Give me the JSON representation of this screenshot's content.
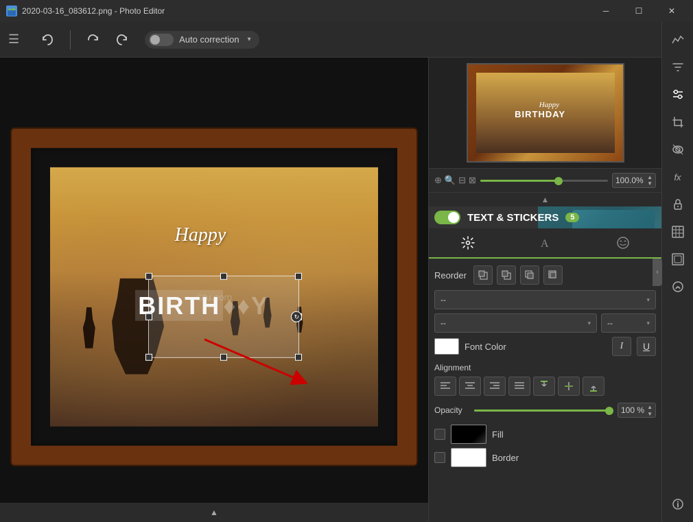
{
  "window": {
    "title": "2020-03-16_083612.png - Photo Editor",
    "icon": "photo-editor-icon"
  },
  "toolbar": {
    "hamburger_label": "☰",
    "undo_label": "↩",
    "redo_prev_label": "↩",
    "redo_label": "↪",
    "autocorrection_label": "Auto correction",
    "autocorrection_arrow": "▾"
  },
  "zoom": {
    "value": "100.0%",
    "icons": [
      "🔍",
      "⊕",
      "⊟",
      "⊠"
    ]
  },
  "text_stickers": {
    "label": "TEXT & STICKERS",
    "badge": "5"
  },
  "panel": {
    "tabs": [
      {
        "icon": "⚙",
        "label": "settings-tab",
        "active": true
      },
      {
        "icon": "A",
        "label": "text-tab",
        "active": false
      },
      {
        "icon": "🏆",
        "label": "stickers-tab",
        "active": false
      }
    ],
    "reorder": {
      "label": "Reorder",
      "buttons": [
        "⬛",
        "⬛",
        "⬛",
        "⬛"
      ]
    },
    "dropdowns": {
      "font_family": "--",
      "font_style": "--",
      "font_size": "--"
    },
    "font_color": {
      "label": "Font Color",
      "color": "#ffffff"
    },
    "alignment": {
      "label": "Alignment",
      "buttons": [
        "align-left",
        "align-center",
        "align-right",
        "align-justify",
        "align-top",
        "align-middle",
        "align-bottom"
      ]
    },
    "opacity": {
      "label": "Opacity",
      "value": "100 %"
    },
    "fill": {
      "label": "Fill",
      "color": "#000000"
    },
    "border": {
      "label": "Border",
      "color": "#ffffff"
    }
  },
  "canvas": {
    "happy_text": "Happy",
    "birthday_text": "BIRTH♦♦Y",
    "watermark": "©tu.com"
  },
  "side_icons": [
    {
      "icon": "📊",
      "name": "histogram-icon"
    },
    {
      "icon": "🧪",
      "name": "filter-icon"
    },
    {
      "icon": "⚙",
      "name": "tune-icon"
    },
    {
      "icon": "⬛",
      "name": "crop-icon"
    },
    {
      "icon": "👓",
      "name": "redeye-icon"
    },
    {
      "icon": "fx",
      "name": "effects-icon"
    },
    {
      "icon": "🔒",
      "name": "lock-icon"
    },
    {
      "icon": "⬛",
      "name": "texture-icon"
    },
    {
      "icon": "🖼",
      "name": "frame-icon"
    },
    {
      "icon": "🐾",
      "name": "ai-icon"
    },
    {
      "icon": "ℹ",
      "name": "info-icon"
    }
  ]
}
